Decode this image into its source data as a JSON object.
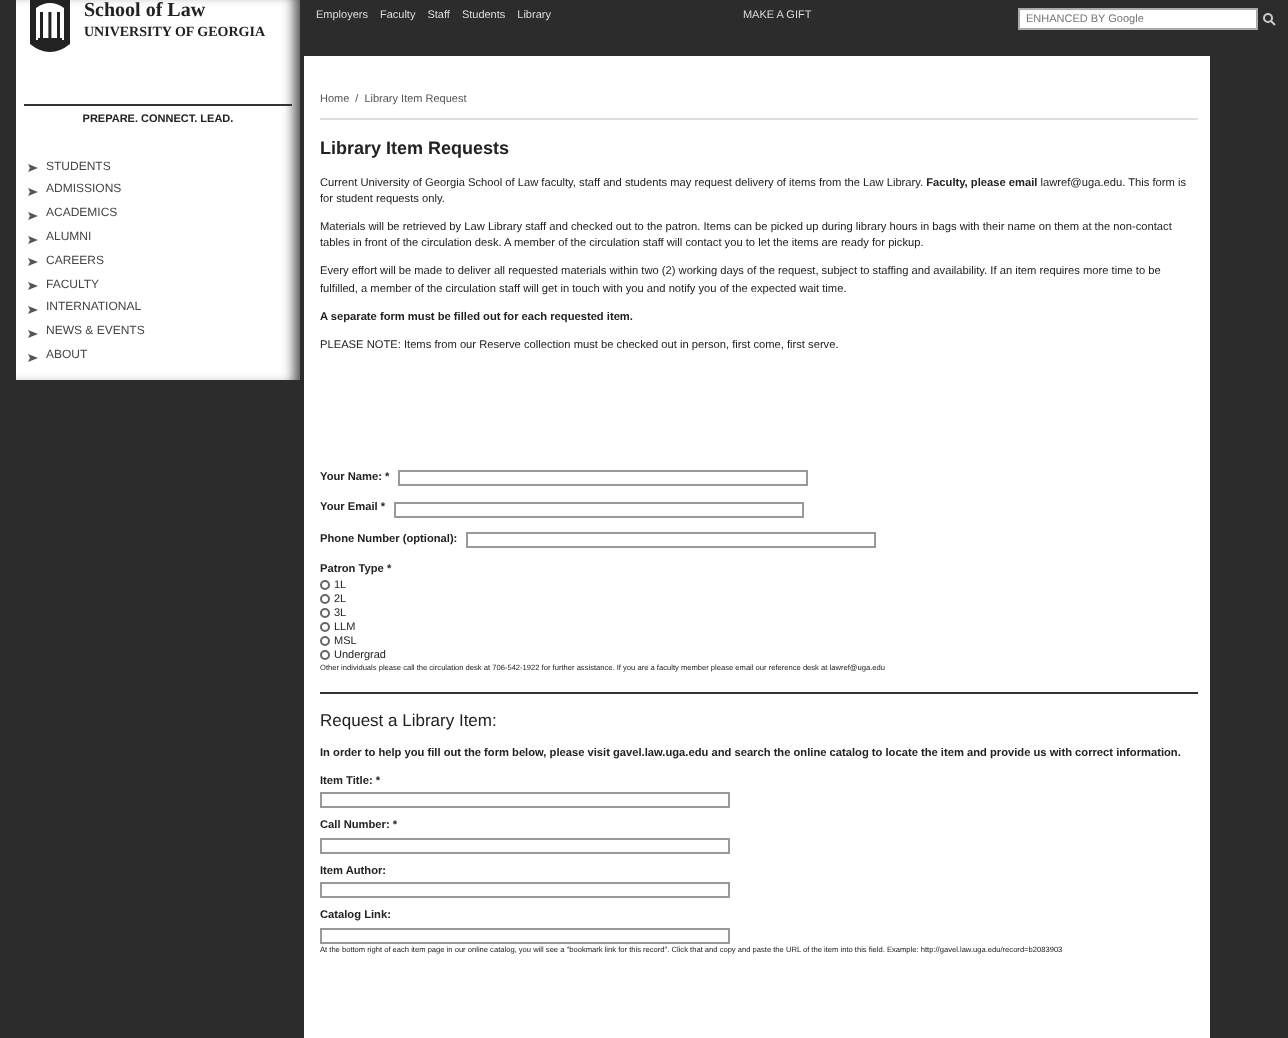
{
  "header": {
    "logo_title": "School of Law",
    "logo_subtitle": "UNIVERSITY OF GEORGIA",
    "tagline": "PREPARE. CONNECT. LEAD.",
    "nav_links": [
      "Employers",
      "Faculty",
      "Staff",
      "Students",
      "Library"
    ],
    "gift_link": "MAKE A GIFT",
    "search": {
      "placeholder": "ENHANCED BY Google"
    }
  },
  "sidebar": {
    "items": [
      {
        "label": "STUDENTS"
      },
      {
        "label": "ADMISSIONS"
      },
      {
        "label": "ACADEMICS"
      },
      {
        "label": "ALUMNI"
      },
      {
        "label": "CAREERS"
      },
      {
        "label": "FACULTY"
      },
      {
        "label": "INTERNATIONAL"
      },
      {
        "label": "NEWS & EVENTS"
      },
      {
        "label": "ABOUT"
      }
    ]
  },
  "breadcrumb": {
    "items": [
      "Home",
      "Library Item Request"
    ],
    "separator": "/"
  },
  "page_title": "Library Item Requests",
  "intro": [
    {
      "text": "Current University of Georgia School of Law faculty, staff and students may request delivery of items from the Law Library. **Faculty, please email**",
      "link": "lawref@uga.edu",
      "after": ". This form is for student requests only."
    },
    {
      "text": "Materials will be retrieved by Law Library staff and checked out to the patron. Items can be picked up during library hours in bags with their name on them at the non-contact tables in front of the circulation desk. A member of the circulation staff will contact you to let the items are ready for pickup."
    },
    {
      "text": "Every effort will be made to deliver all requested materials within two (2) working days of the request, subject to staffing and availability. If an item requires more time to be fulfilled, a member of the circulation staff will get in touch with you and notify you of the expected wait time."
    },
    {
      "text": "A separate form must be filled out for each requested item.",
      "bold": true
    },
    {
      "text": "PLEASE NOTE:  Items from our Reserve collection must be checked out in person, first come, first serve."
    }
  ],
  "contact_fields": [
    {
      "label": "Your Name: *"
    },
    {
      "label": "Your Email *"
    },
    {
      "label": "Phone Number (optional):"
    }
  ],
  "patron_type": {
    "label": "Patron Type *",
    "options": [
      {
        "label": "1L",
        "selected": false
      },
      {
        "label": "2L",
        "selected": false
      },
      {
        "label": "3L",
        "selected": false
      },
      {
        "label": "LLM",
        "selected": false
      },
      {
        "label": "MSL",
        "selected": false
      },
      {
        "label": "Undergrad",
        "selected": false
      }
    ],
    "note": "Other individuals please call the circulation desk at 706-542-1922 for further assistance. If you are a faculty member please email our reference desk at",
    "note_link": "lawref@uga.edu"
  },
  "request": {
    "title": "Request a Library Item:",
    "intro": {
      "text": "In order to help you fill out the form below, please visit",
      "link": "gavel.law.uga.edu",
      "after": "and search the online catalog to locate the item and provide us with correct information.",
      "bold": true
    },
    "fields": [
      {
        "label": "Item Title: *"
      },
      {
        "label": "Call Number: *"
      },
      {
        "label": "Item Author:"
      },
      {
        "label": "Catalog Link:"
      }
    ],
    "note": "At the bottom right of each item page in our online catalog, you will see a \"bookmark link for this record\". Click that and copy and paste the URL of the item into this field. Example: http://gavel.law.uga.edu/record=b2083903"
  }
}
